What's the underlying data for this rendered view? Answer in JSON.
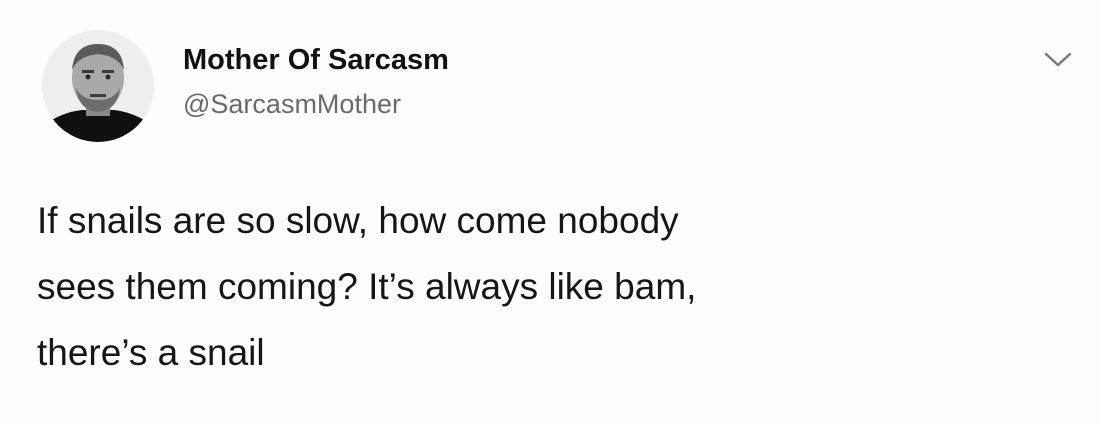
{
  "tweet": {
    "author": {
      "display_name": "Mother Of Sarcasm",
      "handle": "@SarcasmMother",
      "avatar_icon": "profile-photo"
    },
    "menu_icon": "chevron-down-icon",
    "text_lines": [
      "If snails are so slow, how come nobody",
      "sees them coming? It’s always like bam,",
      "there’s a snail"
    ]
  }
}
